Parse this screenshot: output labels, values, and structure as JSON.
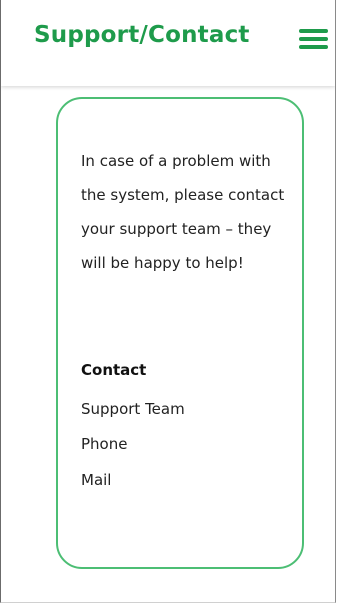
{
  "header": {
    "title": "Support/Contact",
    "menu_icon": "hamburger-menu-icon"
  },
  "card": {
    "message": "In case of a problem with the system, please contact your support team – they will be happy to help!",
    "contact_heading": "Contact",
    "contact_items": [
      "Support Team",
      "Phone",
      "Mail"
    ]
  },
  "colors": {
    "brand_green": "#1e9b4b",
    "card_border": "#4cbe74",
    "text": "#222222"
  }
}
